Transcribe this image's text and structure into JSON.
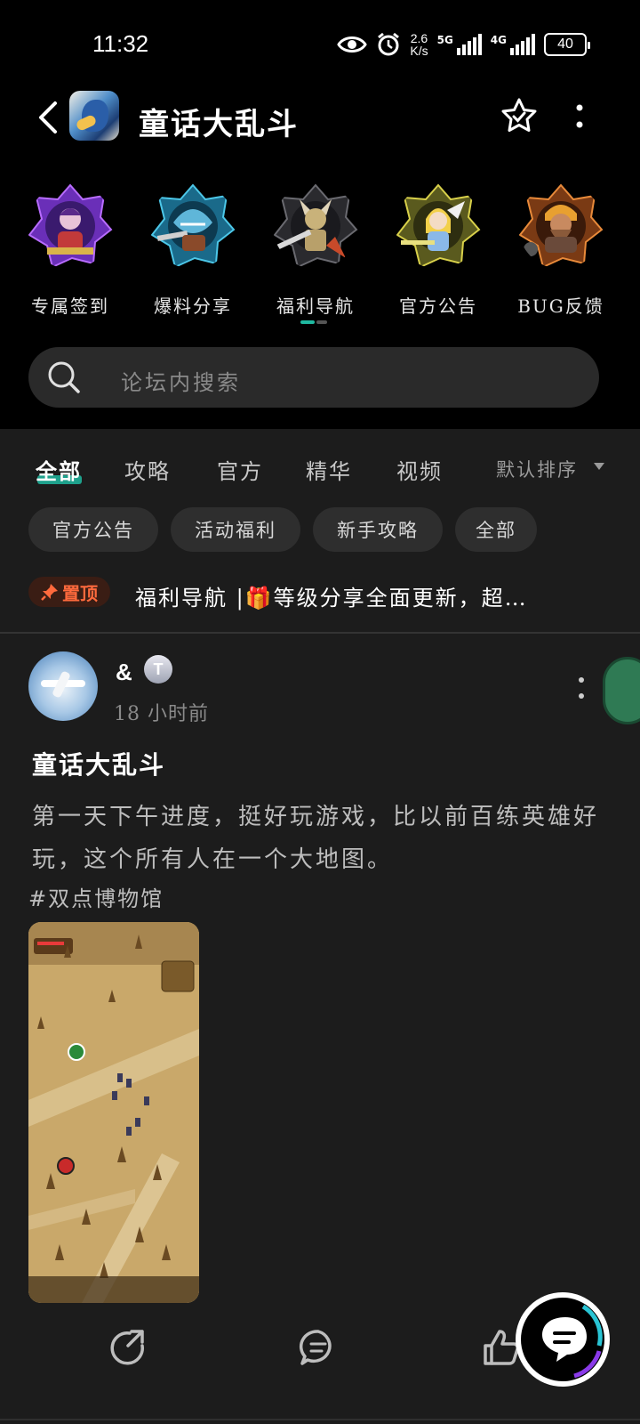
{
  "status_bar": {
    "time": "11:32",
    "net_speed_value": "2.6",
    "net_speed_unit": "K/s",
    "sim1_label": "5G",
    "sim2_label": "4G",
    "battery": "40"
  },
  "header": {
    "title": "童话大乱斗"
  },
  "categories": [
    {
      "label": "专属签到",
      "icon": "purple-hero-emblem-icon"
    },
    {
      "label": "爆料分享",
      "icon": "shark-hero-emblem-icon"
    },
    {
      "label": "福利导航",
      "icon": "knight-hero-emblem-icon"
    },
    {
      "label": "官方公告",
      "icon": "princess-hero-emblem-icon"
    },
    {
      "label": "BUG反馈",
      "icon": "dwarf-hero-emblem-icon"
    }
  ],
  "search": {
    "placeholder": "论坛内搜索"
  },
  "tabs": [
    {
      "label": "全部",
      "active": true
    },
    {
      "label": "攻略",
      "active": false
    },
    {
      "label": "官方",
      "active": false
    },
    {
      "label": "精华",
      "active": false
    },
    {
      "label": "视频",
      "active": false
    }
  ],
  "sort_label": "默认排序",
  "chips": [
    "官方公告",
    "活动福利",
    "新手攻略",
    "全部"
  ],
  "pinned": {
    "badge": "置顶",
    "text": "福利导航 |🎁等级分享全面更新，超…"
  },
  "post": {
    "username": "&",
    "level": "T",
    "time": "18 小时前",
    "title": "童话大乱斗",
    "body": "第一天下午进度，挺好玩游戏，比以前百练英雄好玩，这个所有人在一个大地图。",
    "tag": "#双点博物馆"
  },
  "colors": {
    "accent": "#1fb8a0",
    "pin": "#ff6a3d",
    "background": "#000000",
    "panel": "#1c1c1c"
  }
}
